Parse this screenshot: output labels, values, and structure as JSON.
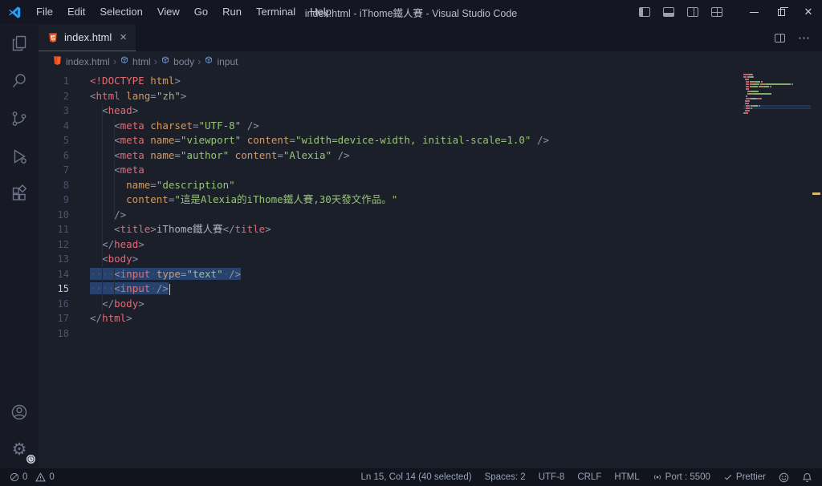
{
  "titlebar": {
    "menus": [
      "File",
      "Edit",
      "Selection",
      "View",
      "Go",
      "Run",
      "Terminal",
      "Help"
    ],
    "title": "index.html - iThome鐵人賽 - Visual Studio Code"
  },
  "icons": {
    "close_tab": "×",
    "more_actions": "⋯",
    "breadcrumb_chevron": "›",
    "gear": "⚙",
    "window_close": "✕"
  },
  "tab": {
    "label": "index.html"
  },
  "breadcrumbs": [
    {
      "label": "index.html",
      "icon": "html-file"
    },
    {
      "label": "html",
      "icon": "symbol-tag"
    },
    {
      "label": "body",
      "icon": "symbol-tag"
    },
    {
      "label": "input",
      "icon": "symbol-tag"
    }
  ],
  "editor": {
    "active_line": 15,
    "lines": [
      {
        "num": 1,
        "tokens": [
          [
            "t",
            "<!DOCTYPE"
          ],
          [
            "a",
            " html"
          ],
          [
            "p",
            ">"
          ]
        ]
      },
      {
        "num": 2,
        "tokens": [
          [
            "p",
            "<"
          ],
          [
            "t",
            "html"
          ],
          [
            "x",
            " "
          ],
          [
            "a",
            "lang"
          ],
          [
            "p",
            "="
          ],
          [
            "s",
            "\"zh\""
          ],
          [
            "p",
            ">"
          ]
        ]
      },
      {
        "num": 3,
        "tokens": [
          [
            "x",
            "  "
          ],
          [
            "p",
            "<"
          ],
          [
            "t",
            "head"
          ],
          [
            "p",
            ">"
          ]
        ]
      },
      {
        "num": 4,
        "tokens": [
          [
            "x",
            "    "
          ],
          [
            "p",
            "<"
          ],
          [
            "t",
            "meta"
          ],
          [
            "x",
            " "
          ],
          [
            "a",
            "charset"
          ],
          [
            "p",
            "="
          ],
          [
            "s",
            "\"UTF-8\""
          ],
          [
            "x",
            " "
          ],
          [
            "p",
            "/>"
          ]
        ]
      },
      {
        "num": 5,
        "tokens": [
          [
            "x",
            "    "
          ],
          [
            "p",
            "<"
          ],
          [
            "t",
            "meta"
          ],
          [
            "x",
            " "
          ],
          [
            "a",
            "name"
          ],
          [
            "p",
            "="
          ],
          [
            "s",
            "\"viewport\""
          ],
          [
            "x",
            " "
          ],
          [
            "a",
            "content"
          ],
          [
            "p",
            "="
          ],
          [
            "s",
            "\"width=device-width, initial-scale=1.0\""
          ],
          [
            "x",
            " "
          ],
          [
            "p",
            "/>"
          ]
        ]
      },
      {
        "num": 6,
        "tokens": [
          [
            "x",
            "    "
          ],
          [
            "p",
            "<"
          ],
          [
            "t",
            "meta"
          ],
          [
            "x",
            " "
          ],
          [
            "a",
            "name"
          ],
          [
            "p",
            "="
          ],
          [
            "s",
            "\"author\""
          ],
          [
            "x",
            " "
          ],
          [
            "a",
            "content"
          ],
          [
            "p",
            "="
          ],
          [
            "s",
            "\"Alexia\""
          ],
          [
            "x",
            " "
          ],
          [
            "p",
            "/>"
          ]
        ]
      },
      {
        "num": 7,
        "tokens": [
          [
            "x",
            "    "
          ],
          [
            "p",
            "<"
          ],
          [
            "t",
            "meta"
          ]
        ]
      },
      {
        "num": 8,
        "tokens": [
          [
            "x",
            "      "
          ],
          [
            "a",
            "name"
          ],
          [
            "p",
            "="
          ],
          [
            "s",
            "\"description\""
          ]
        ]
      },
      {
        "num": 9,
        "tokens": [
          [
            "x",
            "      "
          ],
          [
            "a",
            "content"
          ],
          [
            "p",
            "="
          ],
          [
            "s",
            "\"這是Alexia的iThome鐵人賽,30天發文作品。\""
          ]
        ]
      },
      {
        "num": 10,
        "tokens": [
          [
            "x",
            "    "
          ],
          [
            "p",
            "/>"
          ]
        ]
      },
      {
        "num": 11,
        "tokens": [
          [
            "x",
            "    "
          ],
          [
            "p",
            "<"
          ],
          [
            "t",
            "title"
          ],
          [
            "p",
            ">"
          ],
          [
            "x",
            "iThome鐵人賽"
          ],
          [
            "p",
            "</"
          ],
          [
            "t",
            "title"
          ],
          [
            "p",
            ">"
          ]
        ]
      },
      {
        "num": 12,
        "tokens": [
          [
            "x",
            "  "
          ],
          [
            "p",
            "</"
          ],
          [
            "t",
            "head"
          ],
          [
            "p",
            ">"
          ]
        ]
      },
      {
        "num": 13,
        "tokens": [
          [
            "x",
            "  "
          ],
          [
            "p",
            "<"
          ],
          [
            "t",
            "body"
          ],
          [
            "p",
            ">"
          ]
        ]
      },
      {
        "num": 14,
        "sel": true,
        "tokens": [
          [
            "w",
            "····"
          ],
          [
            "p",
            "<"
          ],
          [
            "t",
            "input"
          ],
          [
            "w",
            "·"
          ],
          [
            "a",
            "type"
          ],
          [
            "p",
            "="
          ],
          [
            "s",
            "\"text\""
          ],
          [
            "w",
            "·"
          ],
          [
            "p",
            "/>"
          ]
        ]
      },
      {
        "num": 15,
        "sel": true,
        "cursor": true,
        "tokens": [
          [
            "w",
            "····"
          ],
          [
            "p",
            "<"
          ],
          [
            "t",
            "input"
          ],
          [
            "w",
            "·"
          ],
          [
            "p",
            "/>"
          ]
        ]
      },
      {
        "num": 16,
        "tokens": [
          [
            "x",
            "  "
          ],
          [
            "p",
            "</"
          ],
          [
            "t",
            "body"
          ],
          [
            "p",
            ">"
          ]
        ]
      },
      {
        "num": 17,
        "tokens": [
          [
            "p",
            "</"
          ],
          [
            "t",
            "html"
          ],
          [
            "p",
            ">"
          ]
        ]
      },
      {
        "num": 18,
        "tokens": []
      }
    ]
  },
  "statusbar": {
    "problems": {
      "errors": "0",
      "warnings": "0"
    },
    "items": [
      {
        "name": "cursor-position",
        "label": "Ln 15, Col 14 (40 selected)"
      },
      {
        "name": "indentation",
        "label": "Spaces: 2"
      },
      {
        "name": "encoding",
        "label": "UTF-8"
      },
      {
        "name": "eol",
        "label": "CRLF"
      },
      {
        "name": "language-mode",
        "label": "HTML"
      },
      {
        "name": "live-server-port",
        "label": "Port : 5500",
        "icon": "broadcast"
      },
      {
        "name": "prettier",
        "label": "Prettier",
        "icon": "check"
      }
    ]
  },
  "colors": {
    "selection": "#27436d",
    "modified_marker": "#dcb66a",
    "tag": "#e06c75",
    "attribute": "#d19a66",
    "string": "#98c379",
    "html_icon": "#e44d26"
  }
}
